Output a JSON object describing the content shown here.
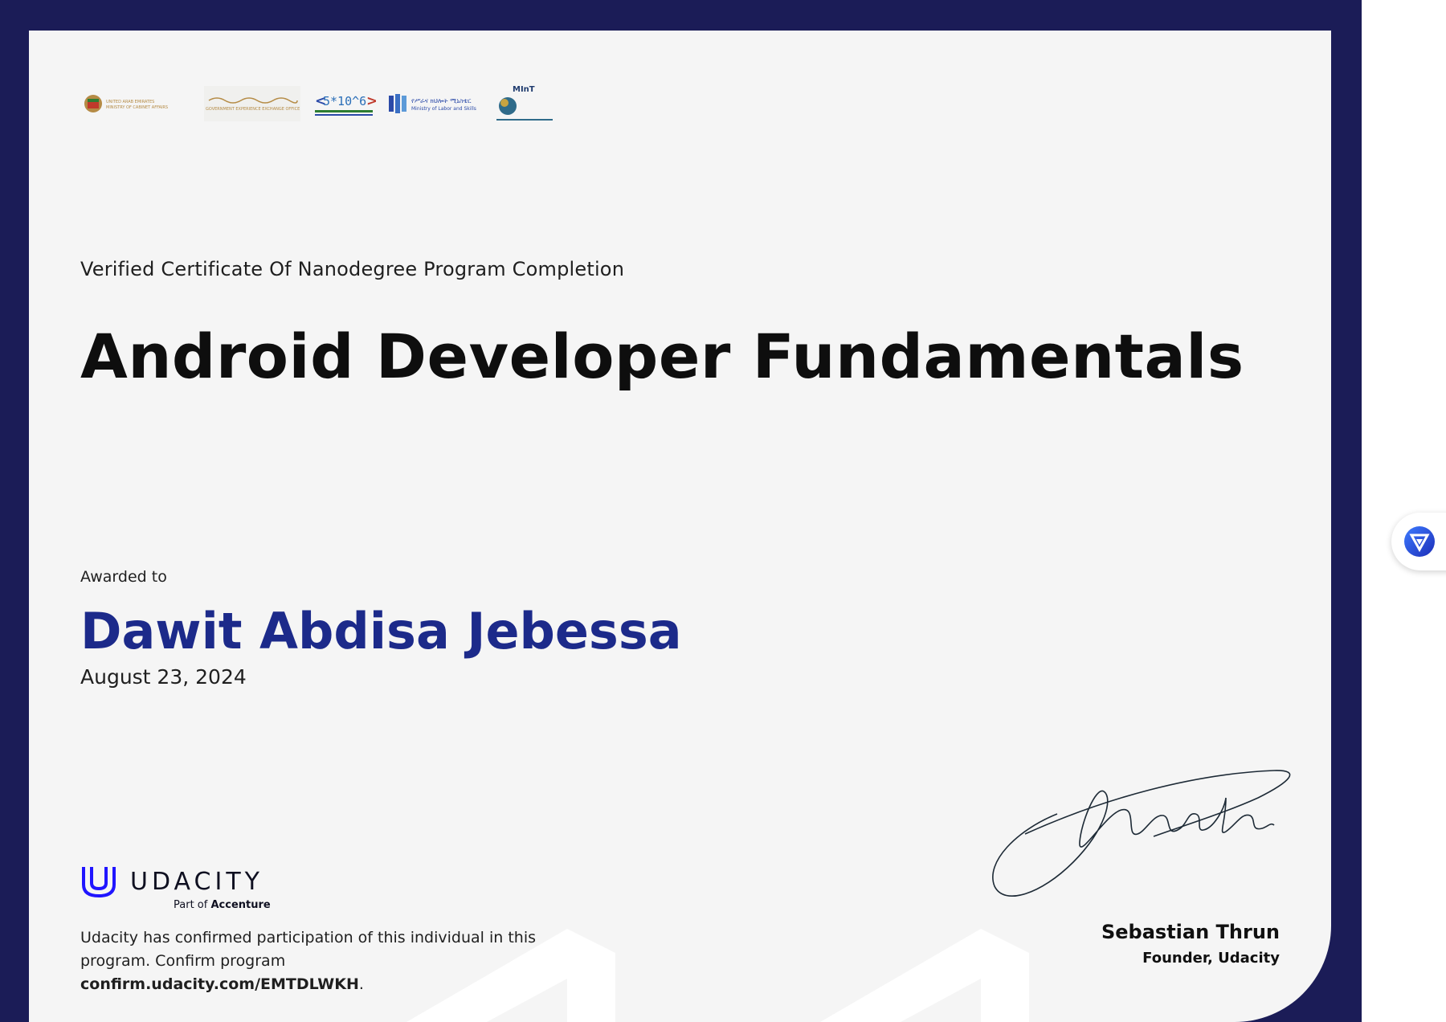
{
  "certificate": {
    "subtitle": "Verified Certificate Of Nanodegree Program Completion",
    "program_title": "Android Developer Fundamentals",
    "awarded_label": "Awarded to",
    "recipient": "Dawit Abdisa Jebessa",
    "date": "August 23, 2024"
  },
  "logos": {
    "uae": "UNITED ARAB EMIRATES MINISTRY OF CABINET AFFAIRS",
    "gov_exchange": "GOVERNMENT EXPERIENCE EXCHANGE OFFICE",
    "five_million": "5*10^6",
    "labor": "Ministry of Labor and Skills",
    "mint": "MInT"
  },
  "branding": {
    "name": "UDACITY",
    "sub_prefix": "Part of",
    "sub_company": "Accenture",
    "colors": {
      "brand": "#2015ff",
      "frame": "#1b1c57",
      "recipient": "#1c2a8a"
    }
  },
  "confirmation": {
    "text": "Udacity has confirmed participation of this individual in this program. Confirm program",
    "url": "confirm.udacity.com/EMTDLWKH",
    "end": "."
  },
  "signatory": {
    "name": "Sebastian Thrun",
    "role": "Founder, Udacity"
  },
  "extension": {
    "icon": "vpn-shield-icon"
  }
}
